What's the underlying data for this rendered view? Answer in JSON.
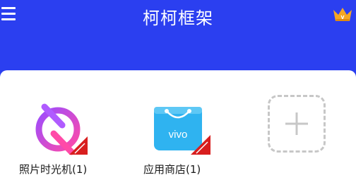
{
  "header": {
    "title": "柯柯框架",
    "menu_icon": "menu-icon",
    "vip_icon": "crown-icon"
  },
  "apps": [
    {
      "label": "照片时光机(1)",
      "icon": "photo-time-machine-icon"
    },
    {
      "label": "应用商店(1)",
      "icon": "vivo-app-store-icon",
      "icon_text": "vivo"
    }
  ],
  "add_tile": {
    "icon": "plus-icon"
  },
  "colors": {
    "header_bg": "#2b3ff0",
    "panel_bg": "#ffffff",
    "photo_icon_purple": "#9b4dff",
    "photo_icon_pink": "#ff4aa8",
    "store_icon_blue": "#2fb3f0",
    "badge_red": "#d81e1e",
    "crown_orange": "#f5a623",
    "dashed_border": "#c7c7c7"
  }
}
